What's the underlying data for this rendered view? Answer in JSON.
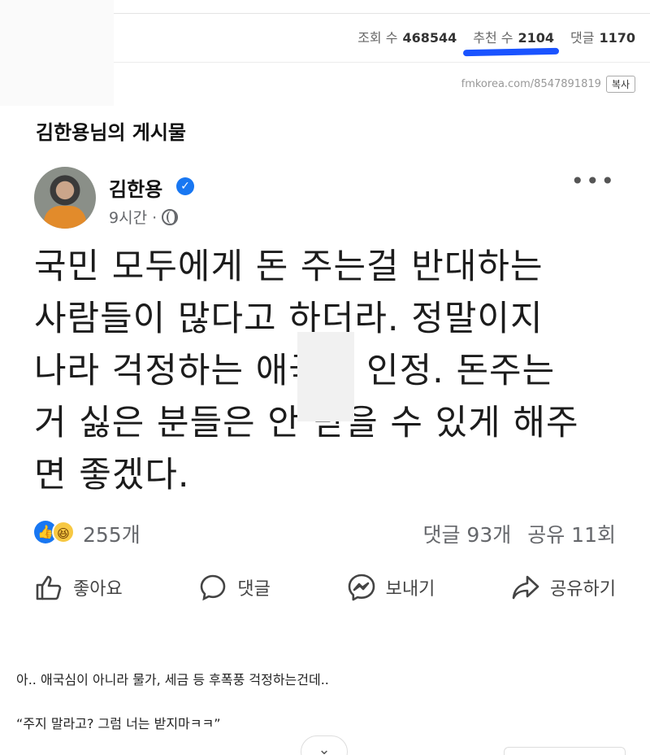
{
  "stats": {
    "views_label": "조회 수",
    "views_value": "468544",
    "recommend_label": "추천 수",
    "recommend_value": "2104",
    "comments_label": "댓글",
    "comments_value": "1170"
  },
  "url": {
    "text": "fmkorea.com/8547891819",
    "copy_label": "복사"
  },
  "page_title": "김한용님의 게시물",
  "post": {
    "author": "김한용",
    "time": "9시간 ·",
    "body_lines": [
      "국민 모두에게 돈 주는걸 반대하는",
      "사람들이 많다고 하더라. 정말이지",
      "나라 걱정하는 애국심 인정. 돈주는",
      "거 싫은 분들은 안 받을 수 있게 해주",
      "면 좋겠다."
    ],
    "reaction_count": "255개",
    "comment_count": "댓글 93개",
    "share_count": "공유 11회"
  },
  "actions": {
    "like": "좋아요",
    "comment": "댓글",
    "send": "보내기",
    "share": "공유하기"
  },
  "comments": [
    "아.. 애국심이 아니라 물가, 세금 등 후폭풍 걱정하는건데..",
    "“주지 말라고? 그럼 너는 받지마ㅋㅋ”"
  ],
  "colors": {
    "accent_underline": "#1a53ff",
    "facebook_blue": "#1877f2"
  }
}
